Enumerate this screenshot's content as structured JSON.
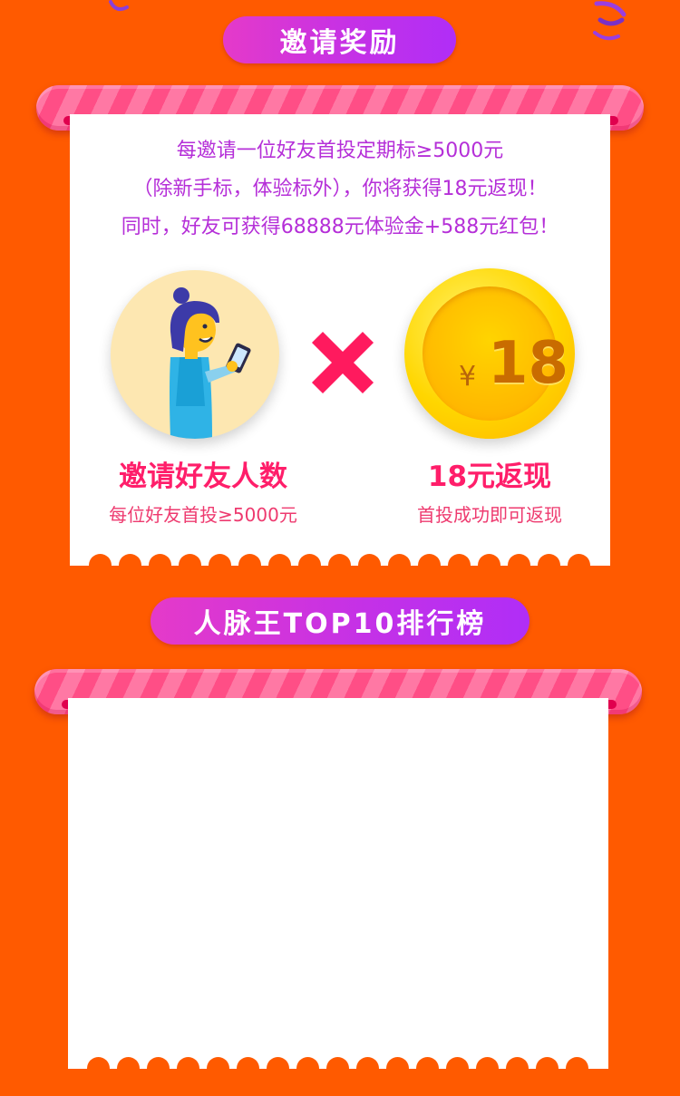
{
  "sections": {
    "invite": {
      "title": "邀请奖励"
    },
    "ranking": {
      "title": "人脉王TOP10排行榜"
    }
  },
  "intro": {
    "line1": "每邀请一位好友首投定期标≥5000元",
    "line2": "（除新手标，体验标外），你将获得18元返现！",
    "line3": "同时，好友可获得68888元体验金+588元红包！"
  },
  "reward": {
    "left_title": "邀请好友人数",
    "left_sub": "每位好友首投≥5000元",
    "operator": "×",
    "coin_symbol": "¥",
    "coin_value": "18",
    "right_title": "18元返现",
    "right_sub": "首投成功即可返现"
  },
  "colors": {
    "background": "#ff5a00",
    "pill_start": "#e53ac9",
    "pill_end": "#b02ef7",
    "accent_pink": "#ff1e6a",
    "intro_purple": "#b52fd8",
    "coin_gold": "#ffd600"
  },
  "icons": [
    "person-with-phone-illustration",
    "multiply-icon",
    "gold-coin-icon"
  ]
}
